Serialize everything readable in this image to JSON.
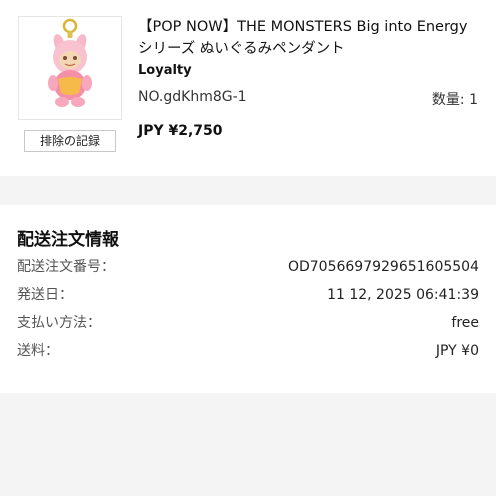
{
  "product": {
    "title_line1": "【POP NOW】THE MONSTERS Big into Energy",
    "title_line2": "シリーズ ぬいぐるみペンダント",
    "brand": "Loyalty",
    "sku": "NO.gdKhm8G-1",
    "quantity": "数量: 1",
    "price": "JPY ¥2,750",
    "remove_label": "排除の記録",
    "image_icon": "plush-keychain-icon"
  },
  "delivery": {
    "title": "配送注文情報",
    "rows": [
      {
        "key": "配送注文番号：",
        "value": "OD7056697929651605504"
      },
      {
        "key": "発送日：",
        "value": "11 12, 2025 06:41:39"
      },
      {
        "key": "支払い方法：",
        "value": "free"
      },
      {
        "key": "送料：",
        "value": "JPY ¥0"
      }
    ]
  }
}
